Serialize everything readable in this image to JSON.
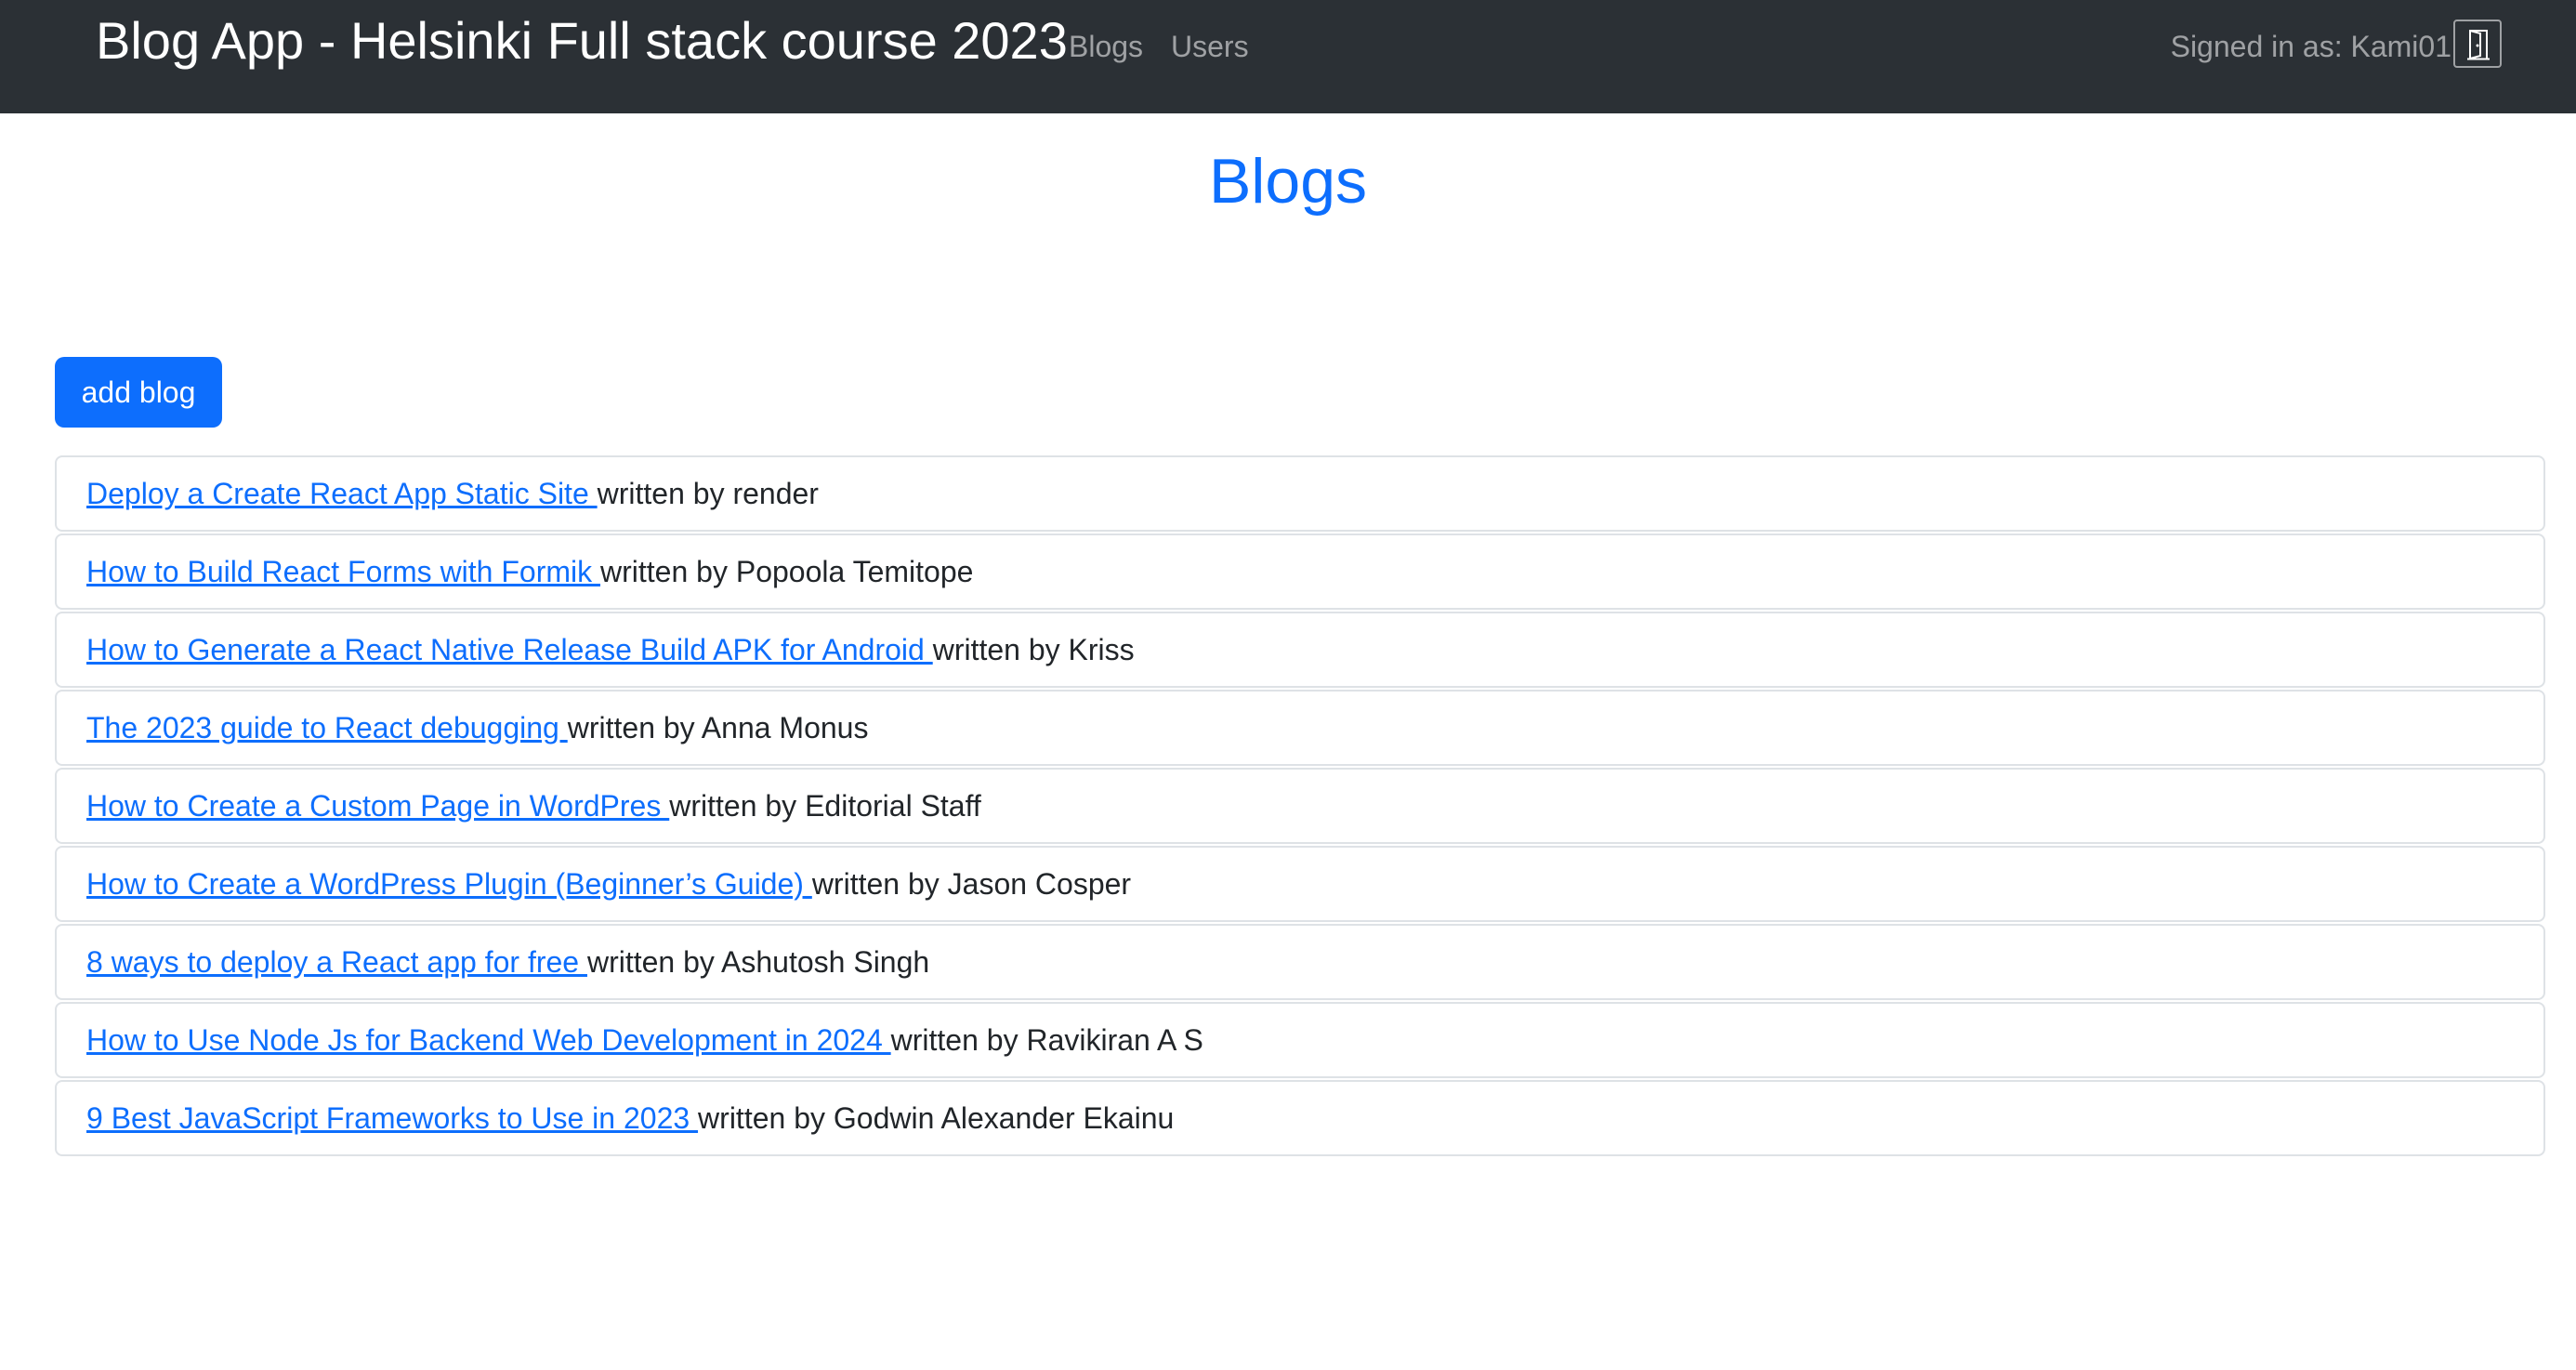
{
  "navbar": {
    "brand": "Blog App - Helsinki Full stack course 2023",
    "links": [
      "Blogs",
      "Users"
    ],
    "signed_in_text": "Signed in as: Kami01",
    "logout_icon": "door-icon"
  },
  "main": {
    "title": "Blogs",
    "add_blog_label": "add blog"
  },
  "blogs": [
    {
      "title": "Deploy a Create React App Static Site ",
      "author": "written by render"
    },
    {
      "title": "How to Build React Forms with Formik ",
      "author": "written by Popoola Temitope"
    },
    {
      "title": "How to Generate a React Native Release Build APK for Android ",
      "author": "written by Kriss"
    },
    {
      "title": "The 2023 guide to React debugging ",
      "author": "written by Anna Monus"
    },
    {
      "title": "How to Create a Custom Page in WordPres ",
      "author": "written by Editorial Staff"
    },
    {
      "title": "How to Create a WordPress Plugin (Beginner’s Guide) ",
      "author": "written by Jason Cosper"
    },
    {
      "title": "8 ways to deploy a React app for free ",
      "author": "written by Ashutosh Singh"
    },
    {
      "title": "How to Use Node Js for Backend Web Development in 2024 ",
      "author": "written by Ravikiran A S"
    },
    {
      "title": "9 Best JavaScript Frameworks to Use in 2023 ",
      "author": "written by Godwin Alexander Ekainu"
    }
  ],
  "colors": {
    "navbar_bg": "#2b3035",
    "primary": "#0d6efd",
    "border": "#dee2e6"
  }
}
